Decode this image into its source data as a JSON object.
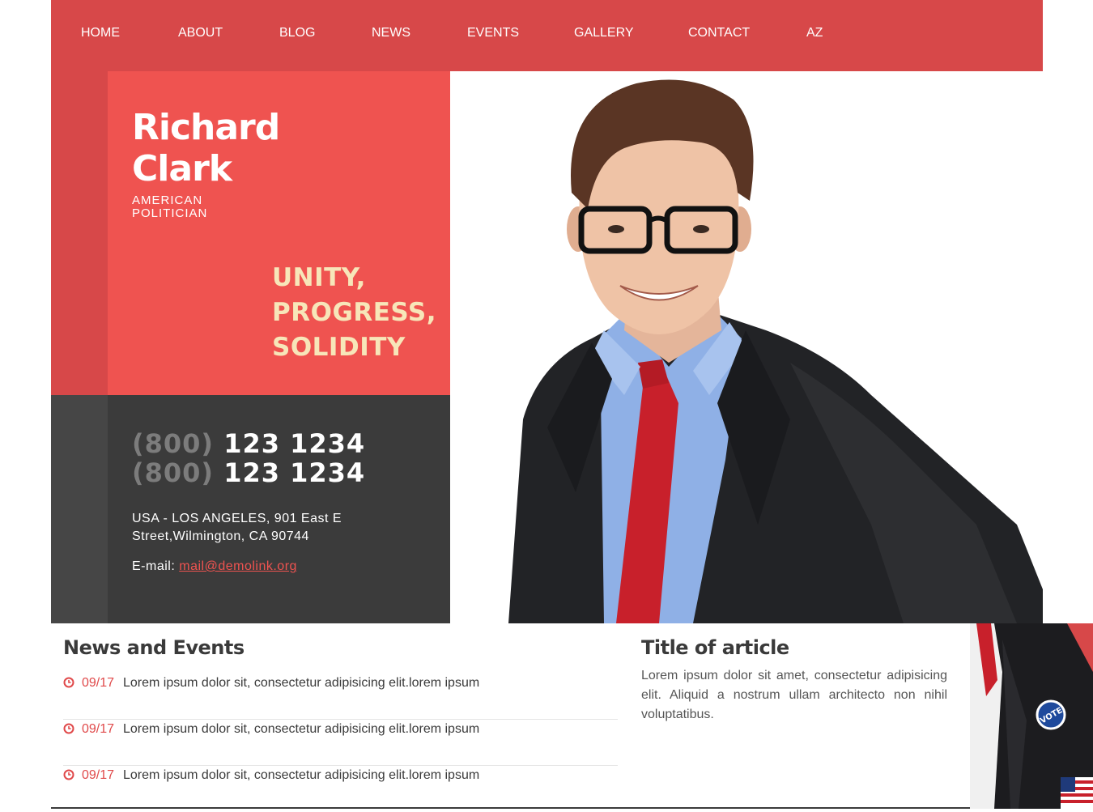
{
  "nav": {
    "items": [
      {
        "label": "HOME"
      },
      {
        "label": "ABOUT"
      },
      {
        "label": "BLOG"
      },
      {
        "label": "NEWS"
      },
      {
        "label": "EVENTS"
      },
      {
        "label": "GALLERY"
      },
      {
        "label": "CONTACT"
      },
      {
        "label": "AZ"
      }
    ]
  },
  "profile": {
    "name_line1": "Richard",
    "name_line2": "Clark",
    "role_line1": "AMERICAN",
    "role_line2": "POLITICIAN",
    "slogan": [
      "UNITY,",
      "PROGRESS,",
      "SOLIDITY"
    ]
  },
  "contact": {
    "phones": [
      {
        "code": "(800)",
        "number": "123 1234"
      },
      {
        "code": "(800)",
        "number": "123 1234"
      }
    ],
    "address_line1": "USA - LOS ANGELES, 901 East E",
    "address_line2": "Street,Wilmington, CA 90744",
    "email_label": "E-mail:",
    "email": "mail@demolink.org"
  },
  "news": {
    "title": "News and Events",
    "items": [
      {
        "date": "09/17",
        "text": "Lorem ipsum dolor sit, consectetur adipisicing elit.lorem ipsum"
      },
      {
        "date": "09/17",
        "text": "Lorem ipsum dolor sit, consectetur adipisicing elit.lorem ipsum"
      },
      {
        "date": "09/17",
        "text": "Lorem ipsum dolor sit, consectetur adipisicing elit.lorem ipsum"
      }
    ]
  },
  "article": {
    "title": "Title of article",
    "body": "Lorem ipsum dolor sit amet, consectetur adipisicing elit. Aliquid a nostrum ullam architecto non nihil voluptatibus."
  },
  "images": {
    "hero": "portrait-photo",
    "thumb": "vote-badge-photo",
    "thumb_badge_text": "VOTE"
  },
  "colors": {
    "nav_red": "#d74849",
    "panel_red": "#ef5350",
    "dark_panel": "#3b3b3b",
    "slogan": "#f7e6b9",
    "accent": "#e0494a"
  }
}
